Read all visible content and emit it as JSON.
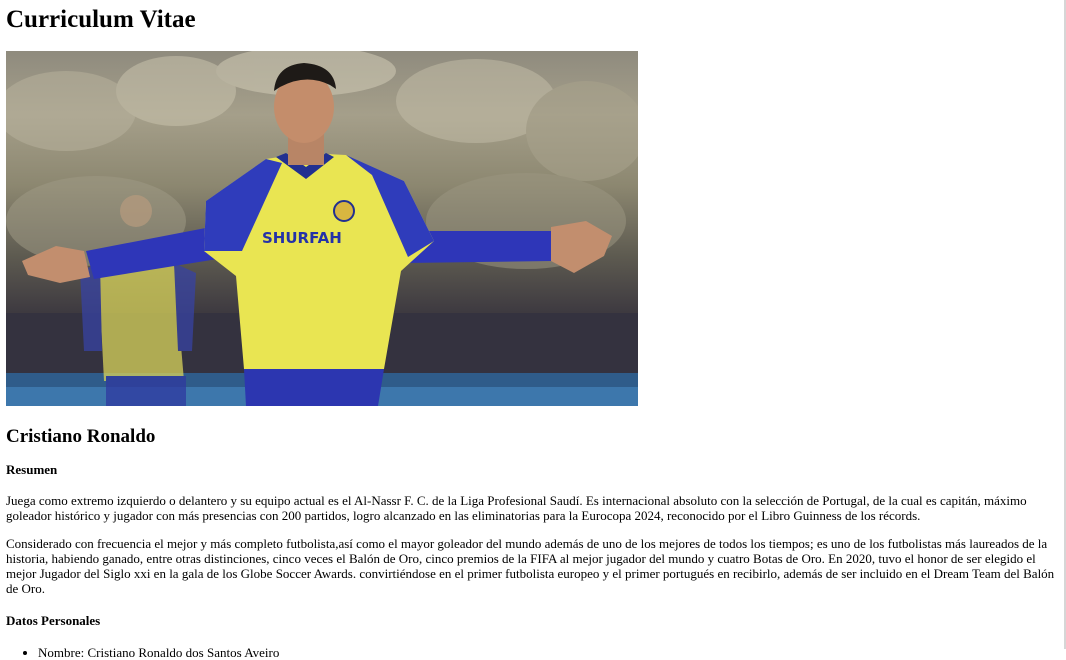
{
  "document": {
    "title": "Curriculum Vitae",
    "photo": {
      "alt": "Cristiano Ronaldo",
      "shirt_sponsor": "SHURFAH"
    },
    "name": "Cristiano Ronaldo",
    "summary_heading": "Resumen",
    "summary_paragraphs": [
      "Juega como extremo izquierdo o delantero y su equipo actual es el Al-Nassr F. C. de la Liga Profesional Saudí. Es internacional absoluto con la selección de Portugal, de la cual es capitán, máximo goleador histórico y jugador con más presencias con 200 partidos, logro alcanzado en las eliminatorias para la Eurocopa 2024, reconocido por el Libro Guinness de los récords.",
      "Considerado con frecuencia el mejor y más completo futbolista,así como el mayor goleador del mundo además de uno de los mejores de todos los tiempos; es uno de los futbolistas más laureados de la historia, habiendo ganado, entre otras distinciones, cinco veces el Balón de Oro, cinco premios de la FIFA al mejor jugador del mundo y cuatro Botas de Oro. En 2020, tuvo el honor de ser elegido el mejor Jugador del Siglo xxi en la gala de los Globe Soccer Awards. convirtiéndose en el primer futbolista europeo y el primer portugués en recibirlo, además de ser incluido en el Dream Team del Balón de Oro."
    ],
    "personal_heading": "Datos Personales",
    "personal_items": [
      "Nombre: Cristiano Ronaldo dos Santos Aveiro"
    ]
  }
}
